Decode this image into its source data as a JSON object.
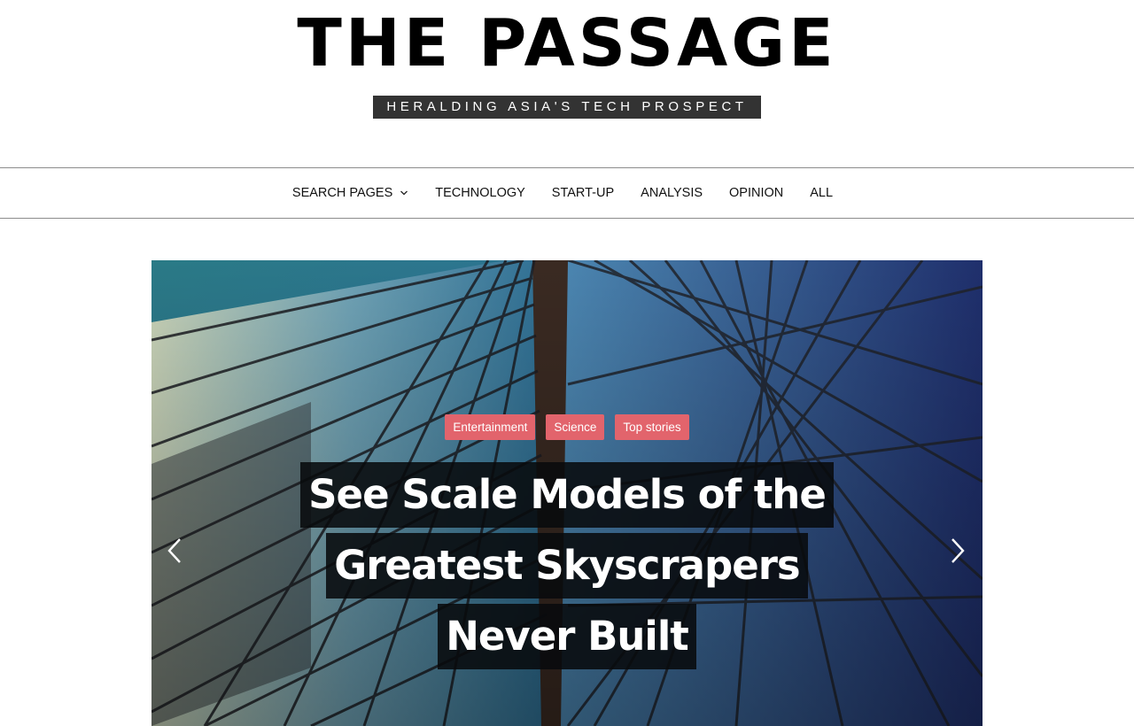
{
  "site": {
    "title": "THE PASSAGE",
    "tagline": "HERALDING ASIA'S TECH PROSPECT"
  },
  "nav": {
    "items": [
      {
        "label": "SEARCH PAGES",
        "has_dropdown": true,
        "icon": "chevron-down-icon"
      },
      {
        "label": "TECHNOLOGY"
      },
      {
        "label": "START-UP"
      },
      {
        "label": "ANALYSIS"
      },
      {
        "label": "OPINION"
      },
      {
        "label": "ALL"
      }
    ]
  },
  "slider": {
    "categories": [
      "Entertainment",
      "Science",
      "Top stories"
    ],
    "headline_lines": [
      "See Scale Models of the",
      "Greatest Skyscrapers",
      "Never Built"
    ],
    "prev_icon": "chevron-left-icon",
    "next_icon": "chevron-right-icon"
  },
  "colors": {
    "tag_background": "#e2646c",
    "tagline_background": "#333333",
    "headline_background": "#0a0c0e"
  }
}
